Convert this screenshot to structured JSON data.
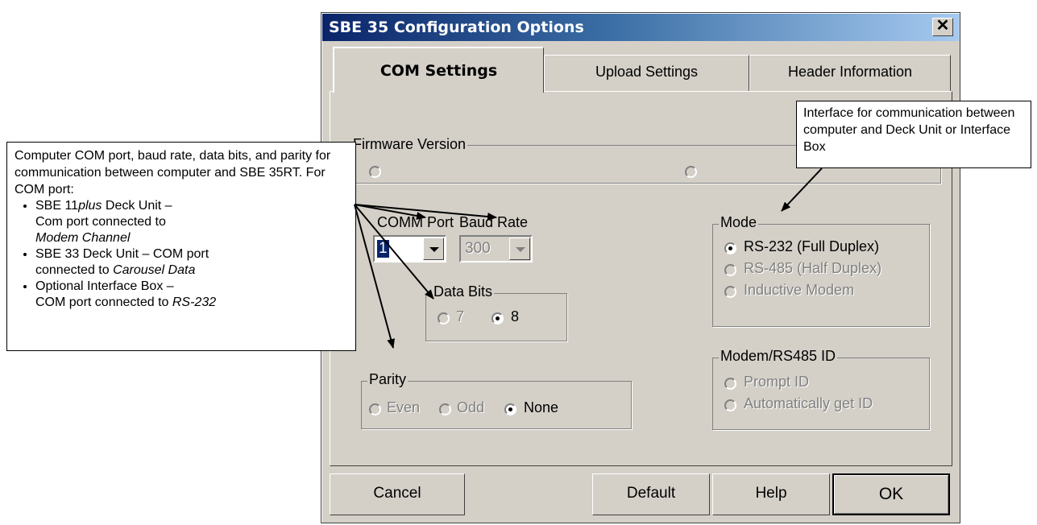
{
  "window": {
    "title": "SBE 35 Configuration Options",
    "close_glyph": "✕"
  },
  "tabs": [
    {
      "label": "COM Settings",
      "active": true
    },
    {
      "label": "Upload Settings",
      "active": false
    },
    {
      "label": "Header Information",
      "active": false
    }
  ],
  "firmware": {
    "group_label": "Firmware Version"
  },
  "comm_port": {
    "label": "COMM Port",
    "value": "1"
  },
  "baud_rate": {
    "label": "Baud Rate",
    "value": "300"
  },
  "data_bits": {
    "group_label": "Data Bits",
    "options": [
      "7",
      "8"
    ],
    "selected": "8"
  },
  "parity": {
    "group_label": "Parity",
    "options": [
      "Even",
      "Odd",
      "None"
    ],
    "selected": "None"
  },
  "mode": {
    "group_label": "Mode",
    "options": [
      "RS-232 (Full Duplex)",
      "RS-485 (Half Duplex)",
      "Inductive Modem"
    ],
    "selected": "RS-232 (Full Duplex)"
  },
  "modem_id": {
    "group_label": "Modem/RS485 ID",
    "options": [
      "Prompt ID",
      "Automatically get ID"
    ]
  },
  "buttons": {
    "cancel": "Cancel",
    "default": "Default",
    "help": "Help",
    "ok": "OK"
  },
  "callout_left": {
    "intro": "Computer COM port, baud rate, data bits, and parity for communication between computer and SBE 35RT. For COM port:",
    "bullets": [
      {
        "line1_pre": "SBE 11",
        "line1_italic": "plus",
        "line1_post": " Deck Unit –",
        "line2": "Com port connected to",
        "line3_italic": "Modem Channel"
      },
      {
        "line1": "SBE 33 Deck Unit – COM port",
        "line2_pre": "connected to ",
        "line2_italic": "Carousel Data"
      },
      {
        "line1": "Optional Interface Box –",
        "line2_pre": "COM port connected to ",
        "line2_italic": "RS-232"
      }
    ]
  },
  "callout_right": {
    "text": "Interface for communication between computer and Deck Unit or Interface Box"
  },
  "colors": {
    "titlebar_start": "#0a246a",
    "titlebar_end": "#a6caf0",
    "face": "#d4d0c8",
    "disabled_text": "#808080"
  }
}
